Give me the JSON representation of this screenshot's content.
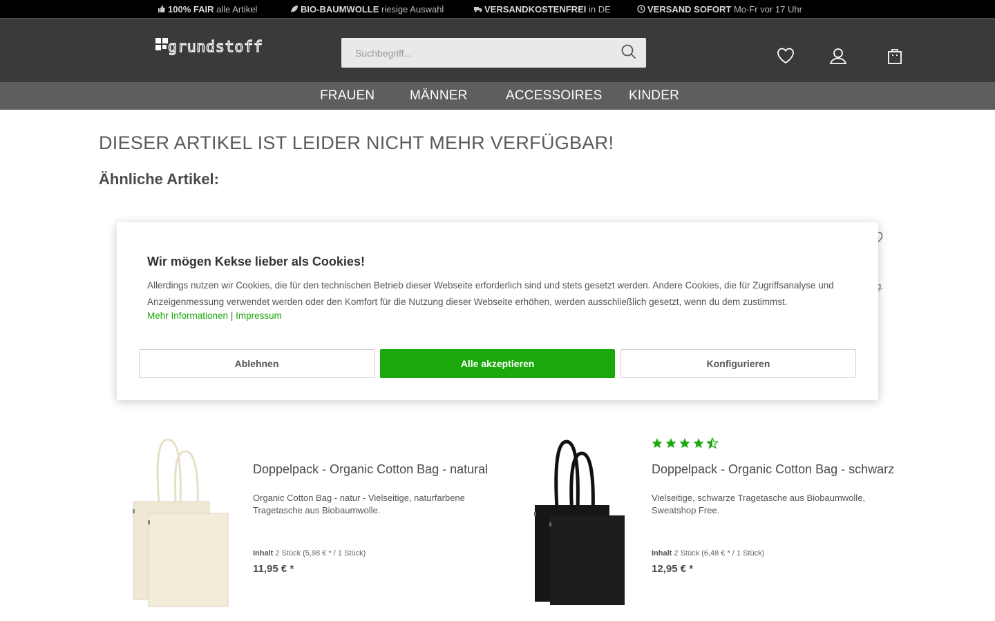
{
  "topbar": {
    "usps": [
      {
        "bold": "100% FAIR",
        "rest": " alle Artikel",
        "icon": "thumbs-up-icon"
      },
      {
        "bold": "BIO-BAUMWOLLE",
        "rest": " riesige Auswahl",
        "icon": "leaf-icon"
      },
      {
        "bold": "VERSANDKOSTENFREI",
        "rest": " in DE",
        "icon": "truck-icon"
      },
      {
        "bold": "VERSAND SOFORT",
        "rest": " Mo-Fr vor 17 Uhr",
        "icon": "clock-icon"
      }
    ]
  },
  "header": {
    "logo_text": "grundstoff",
    "search_placeholder": "Suchbegriff...",
    "icons": [
      "heart-icon",
      "user-icon",
      "shopping-bag-icon"
    ]
  },
  "nav": {
    "items": [
      "FRAUEN",
      "MÄNNER",
      "ACCESSOIRES",
      "KINDER"
    ]
  },
  "main": {
    "title": "DIESER ARTIKEL IST LEIDER NICHT MEHR VERFÜGBAR!",
    "similar_heading": "Ähnliche Artikel:"
  },
  "products": [
    {
      "title": "Doppelpack - Organic Cotton Bag - natural",
      "desc": "Organic Cotton Bag - natur - Vielseitige, naturfarbene Tragetasche aus Biobaumwolle.",
      "content_label": "Inhalt",
      "content_value": " 2 Stück (5,98 € * / 1 Stück)",
      "price": "11,95 € *",
      "color": "#efe9d6"
    },
    {
      "title": "Doppelpack - Organic Cotton Bag - schwarz",
      "desc": "Vielseitige, schwarze Tragetasche aus Biobaumwolle, Sweatshop Free.",
      "content_label": "Inhalt",
      "content_value": " 2 Stück (6,48 € * / 1 Stück)",
      "price": "12,95 € *",
      "rating": 4.5,
      "color": "#151515"
    }
  ],
  "cookie": {
    "title": "Wir mögen Kekse lieber als Cookies!",
    "text": "Allerdings nutzen wir Cookies, die für den technischen Betrieb dieser Webseite erforderlich sind und stets gesetzt werden. Andere Cookies, die für Zugriffsanalyse und Anzeigenmessung verwendet werden oder den Komfort für die Nutzung dieser Webseite erhöhen, werden ausschließlich gesetzt, wenn du dem zustimmst.",
    "link_more": "Mehr Informationen",
    "separator": "|",
    "link_imprint": "Impressum",
    "btn_decline": "Ablehnen",
    "btn_accept": "Alle akzeptieren",
    "btn_configure": "Konfigurieren",
    "accent": "#1aa80a"
  },
  "background_fragment": "g."
}
